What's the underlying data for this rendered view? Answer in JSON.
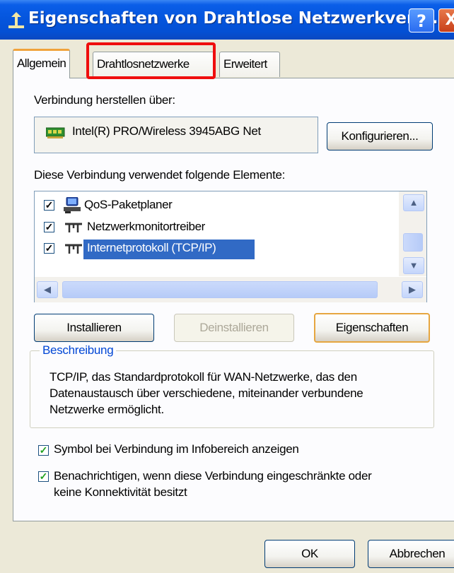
{
  "window": {
    "title": "Eigenschaften von Drahtlose Netzwerkverbi...",
    "help_label": "?",
    "close_label": "X",
    "icon": "network-connection-icon"
  },
  "tabs": [
    {
      "label": "Allgemein",
      "active": true
    },
    {
      "label": "Drahtlosnetzwerke",
      "active": false,
      "highlighted": true
    },
    {
      "label": "Erweitert",
      "active": false
    }
  ],
  "highlight_color": "#ef0d0d",
  "connection": {
    "label": "Verbindung herstellen über:",
    "adapter_name": "Intel(R) PRO/Wireless 3945ABG Net",
    "adapter_icon": "network-card-icon",
    "configure_label": "Konfigurieren..."
  },
  "elements": {
    "label": "Diese Verbindung verwendet folgende Elemente:",
    "items": [
      {
        "label": "QoS-Paketplaner",
        "checked": true,
        "icon": "qos-scheduler-icon",
        "selected": false
      },
      {
        "label": "Netzwerkmonitortreiber",
        "checked": true,
        "icon": "protocol-icon",
        "selected": false
      },
      {
        "label": "Internetprotokoll (TCP/IP)",
        "checked": true,
        "icon": "protocol-icon",
        "selected": true
      }
    ],
    "selection_color": "#316ac5"
  },
  "buttons": {
    "install": "Installieren",
    "uninstall": "Deinstallieren",
    "properties": "Eigenschaften",
    "ok": "OK",
    "cancel": "Abbrechen"
  },
  "description": {
    "title": "Beschreibung",
    "text": "TCP/IP, das Standardprotokoll für WAN-Netzwerke, das den\nDatenaustausch über verschiedene, miteinander verbundene\nNetzwerke ermöglicht."
  },
  "options": [
    {
      "label": "Symbol bei Verbindung im Infobereich anzeigen",
      "checked": true
    },
    {
      "label": "Benachrichtigen, wenn diese Verbindung eingeschränkte oder\nkeine Konnektivität besitzt",
      "checked": true
    }
  ]
}
